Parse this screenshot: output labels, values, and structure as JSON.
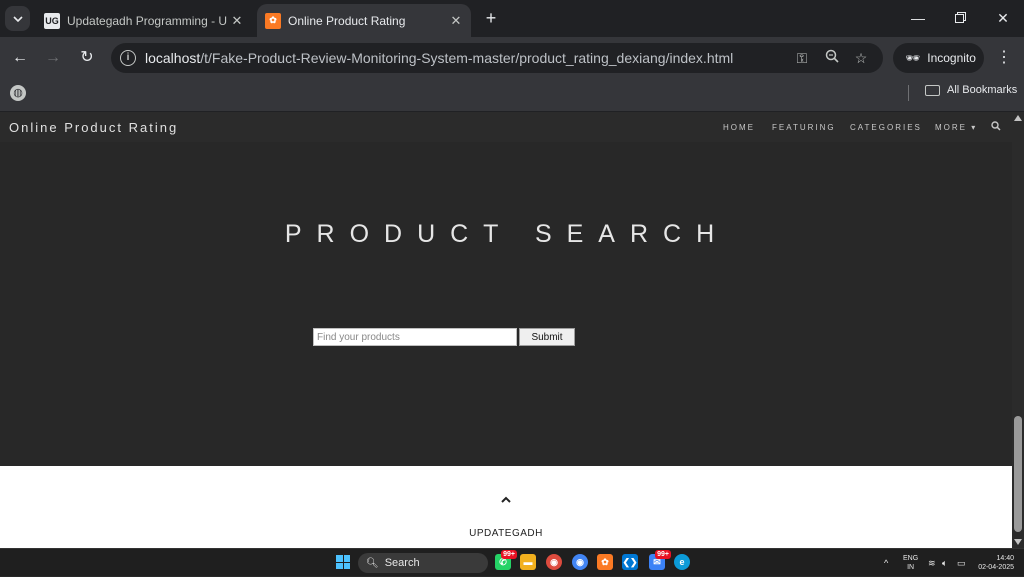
{
  "browser": {
    "tabs": [
      {
        "title": "Updategadh Programming - Upda",
        "favicon": "UG",
        "active": false
      },
      {
        "title": "Online Product Rating",
        "favicon": "xampp-icon",
        "active": true
      }
    ],
    "url_host": "localhost",
    "url_path": "/t/Fake-Product-Review-Monitoring-System-master/product_rating_dexiang/index.html",
    "incognito_label": "Incognito",
    "all_bookmarks_label": "All Bookmarks"
  },
  "site": {
    "brand": "Online Product Rating",
    "nav": [
      "HOME",
      "FEATURING",
      "CATEGORIES",
      "MORE ▾"
    ],
    "hero_title": "PRODUCT SEARCH",
    "search_placeholder": "Find your products",
    "submit_label": "Submit",
    "footer_brand": "UPDATEGADH"
  },
  "taskbar": {
    "search_label": "Search",
    "badge_count": "99+",
    "lang_top": "ENG",
    "lang_bottom": "IN",
    "time": "14:40",
    "date": "02-04-2025"
  },
  "colors": {
    "page_bg": "#282828",
    "chrome_dark": "#202124",
    "chrome_mid": "#35363a",
    "accent_windows": "#4cc2ff",
    "xampp_orange": "#fb7a24"
  }
}
